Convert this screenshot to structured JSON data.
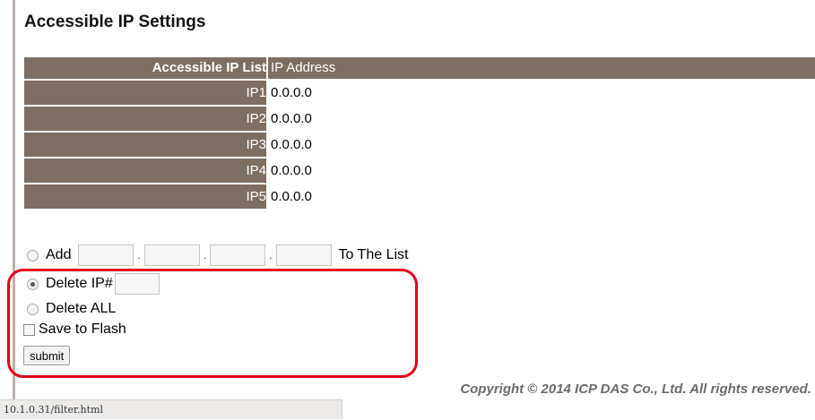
{
  "page": {
    "title": "Accessible IP Settings"
  },
  "table": {
    "header_left": "Accessible IP List",
    "header_right": "IP Address",
    "rows": [
      {
        "label": "IP1",
        "value": "0.0.0.0"
      },
      {
        "label": "IP2",
        "value": "0.0.0.0"
      },
      {
        "label": "IP3",
        "value": "0.0.0.0"
      },
      {
        "label": "IP4",
        "value": "0.0.0.0"
      },
      {
        "label": "IP5",
        "value": "0.0.0.0"
      }
    ]
  },
  "form": {
    "add_label": "Add",
    "add_suffix": "To The List",
    "dot": ".",
    "add_octets": [
      "",
      "",
      "",
      ""
    ],
    "delete_ip_label": "Delete IP#",
    "delete_ip_value": "",
    "delete_all_label": "Delete ALL",
    "save_flash_label": "Save to Flash",
    "submit_label": "submit",
    "selected_option": "delete_ip"
  },
  "footer": {
    "copyright": "Copyright © 2014 ICP DAS Co., Ltd. All rights reserved.",
    "status_url": "10.1.0.31/filter.html"
  },
  "colors": {
    "table_bg": "#7d6f63",
    "highlight": "#e3001b"
  }
}
